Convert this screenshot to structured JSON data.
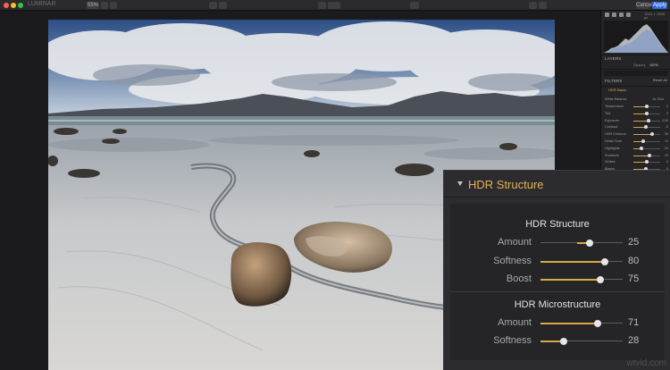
{
  "toolbar": {
    "app_title": "LUMINAR",
    "zoom": "55%",
    "cancel_label": "Cancel",
    "apply_label": "Apply"
  },
  "right_panel": {
    "histogram_info": "1064 × 2838 px",
    "layers_label": "LAYERS",
    "opacity_label": "Opacity",
    "opacity_value": "100%",
    "filters_label": "FILTERS",
    "reset_label": "Reset All",
    "filter_name": "HDR Basic",
    "white_balance_label": "White Balance",
    "white_balance_value": "As Shot",
    "rows": [
      {
        "label": "Temperature",
        "fill": 0.5,
        "value": "0"
      },
      {
        "label": "Tint",
        "fill": 0.5,
        "value": "0"
      },
      {
        "label": "Exposure",
        "fill": 0.55,
        "value": "0.50"
      },
      {
        "label": "Contrast",
        "fill": 0.45,
        "value": "-5"
      },
      {
        "label": "HDR Enhance",
        "fill": 0.7,
        "value": "36"
      },
      {
        "label": "Detail Tone",
        "fill": 0.35,
        "value": "12"
      },
      {
        "label": "Highlights",
        "fill": 0.3,
        "value": "-20"
      },
      {
        "label": "Shadows",
        "fill": 0.6,
        "value": "20"
      },
      {
        "label": "Whites",
        "fill": 0.5,
        "value": "0"
      },
      {
        "label": "Blacks",
        "fill": 0.45,
        "value": "-5"
      }
    ]
  },
  "hdr_structure": {
    "title": "HDR Structure",
    "sections": [
      {
        "heading": "HDR Structure",
        "sliders": [
          {
            "label": "Amount",
            "value": "25",
            "position": 0.6,
            "fill_from": 0.45
          },
          {
            "label": "Softness",
            "value": "80",
            "position": 0.78,
            "fill_from": 0.0
          },
          {
            "label": "Boost",
            "value": "75",
            "position": 0.73,
            "fill_from": 0.0
          }
        ]
      },
      {
        "heading": "HDR Microstructure",
        "sliders": [
          {
            "label": "Amount",
            "value": "71",
            "position": 0.7,
            "fill_from": 0.0
          },
          {
            "label": "Softness",
            "value": "28",
            "position": 0.28,
            "fill_from": 0.0
          }
        ]
      }
    ]
  },
  "watermark": "wtvid.com",
  "colors": {
    "accent": "#d9a84b",
    "title_accent": "#e6b24a",
    "apply_blue": "#2a6ad8"
  }
}
